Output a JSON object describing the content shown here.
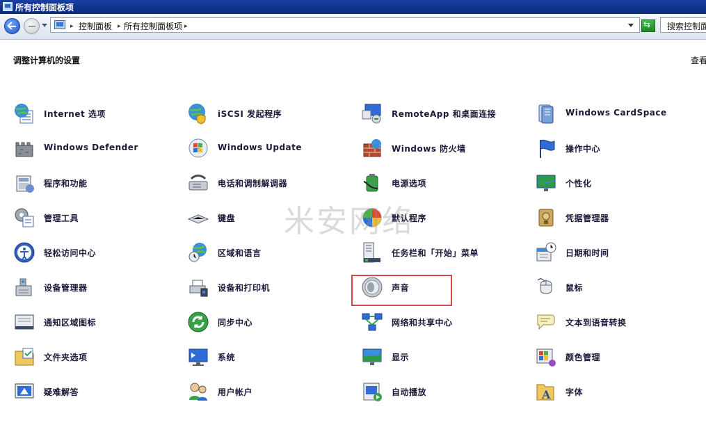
{
  "window": {
    "title": "所有控制面板项"
  },
  "address": {
    "breadcrumbs": [
      "控制面板",
      "所有控制面板项"
    ],
    "search_placeholder": "搜索控制面"
  },
  "main": {
    "heading": "调整计算机的设置",
    "view_by_label": "查看",
    "watermark": "米安网络",
    "highlighted_item": "声音",
    "items": [
      {
        "label": "Internet 选项",
        "icon": "globe-checklist-icon"
      },
      {
        "label": "iSCSI 发起程序",
        "icon": "globe-shield-icon"
      },
      {
        "label": "RemoteApp 和桌面连接",
        "icon": "remote-desktop-icon"
      },
      {
        "label": "Windows CardSpace",
        "icon": "cardspace-icon"
      },
      {
        "label": "Windows Defender",
        "icon": "defender-castle-icon"
      },
      {
        "label": "Windows Update",
        "icon": "windows-update-icon"
      },
      {
        "label": "Windows 防火墙",
        "icon": "firewall-icon"
      },
      {
        "label": "操作中心",
        "icon": "action-center-flag-icon"
      },
      {
        "label": "程序和功能",
        "icon": "programs-icon"
      },
      {
        "label": "电话和调制解调器",
        "icon": "phone-modem-icon"
      },
      {
        "label": "电源选项",
        "icon": "power-options-icon"
      },
      {
        "label": "个性化",
        "icon": "personalization-icon"
      },
      {
        "label": "管理工具",
        "icon": "admin-tools-icon"
      },
      {
        "label": "键盘",
        "icon": "keyboard-icon"
      },
      {
        "label": "默认程序",
        "icon": "default-programs-icon"
      },
      {
        "label": "凭据管理器",
        "icon": "credential-manager-icon"
      },
      {
        "label": "轻松访问中心",
        "icon": "ease-of-access-icon"
      },
      {
        "label": "区域和语言",
        "icon": "region-language-icon"
      },
      {
        "label": "任务栏和「开始」菜单",
        "icon": "taskbar-start-icon"
      },
      {
        "label": "日期和时间",
        "icon": "date-time-icon"
      },
      {
        "label": "设备管理器",
        "icon": "device-manager-icon"
      },
      {
        "label": "设备和打印机",
        "icon": "devices-printers-icon"
      },
      {
        "label": "声音",
        "icon": "sound-speaker-icon"
      },
      {
        "label": "鼠标",
        "icon": "mouse-icon"
      },
      {
        "label": "通知区域图标",
        "icon": "notification-area-icon"
      },
      {
        "label": "同步中心",
        "icon": "sync-center-icon"
      },
      {
        "label": "网络和共享中心",
        "icon": "network-sharing-icon"
      },
      {
        "label": "文本到语音转换",
        "icon": "text-to-speech-icon"
      },
      {
        "label": "文件夹选项",
        "icon": "folder-options-icon"
      },
      {
        "label": "系统",
        "icon": "system-icon"
      },
      {
        "label": "显示",
        "icon": "display-icon"
      },
      {
        "label": "颜色管理",
        "icon": "color-management-icon"
      },
      {
        "label": "疑难解答",
        "icon": "troubleshooting-icon"
      },
      {
        "label": "用户帐户",
        "icon": "user-accounts-icon"
      },
      {
        "label": "自动播放",
        "icon": "autoplay-icon"
      },
      {
        "label": "字体",
        "icon": "fonts-icon"
      }
    ]
  }
}
